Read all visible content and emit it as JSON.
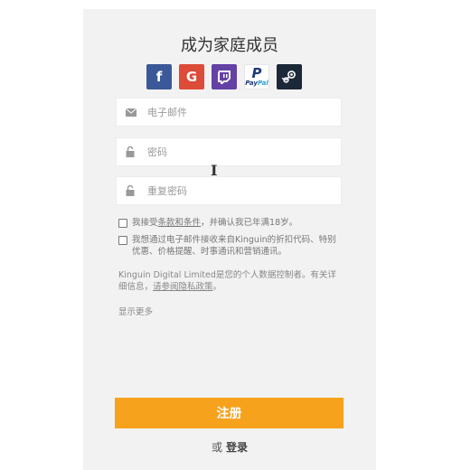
{
  "form": {
    "title": "成为家庭成员",
    "social": {
      "facebook": "f",
      "google": "G",
      "paypal_mark": "P",
      "paypal_pay": "Pay",
      "paypal_pal": "Pal"
    },
    "fields": {
      "email_placeholder": "电子邮件",
      "password_placeholder": "密码",
      "repeat_password_placeholder": "重复密码"
    },
    "checks": {
      "terms_prefix": "我接受",
      "terms_link": "条款和条件",
      "terms_suffix": "，并确认我已年满18岁。",
      "marketing": "我想通过电子邮件接收来自Kinguin的折扣代码、特别优惠、价格提醒、时事通讯和营销通讯。"
    },
    "notice_text": "Kinguin Digital Limited是您的个人数据控制者。有关详细信息，",
    "notice_link": "请参阅隐私政策",
    "notice_end": "。",
    "show_more": "显示更多",
    "register_label": "注册",
    "or_label": "或",
    "login_label": "登录"
  },
  "icons": [
    "facebook-icon",
    "google-icon",
    "twitch-icon",
    "paypal-icon",
    "steam-icon",
    "envelope-icon",
    "lock-icon",
    "text-cursor-icon"
  ],
  "colors": {
    "accent": "#f7a21c",
    "facebook": "#3b5998",
    "google": "#dd4b39",
    "twitch": "#6441a5",
    "steam": "#1b2838",
    "panel": "#f2f2f2"
  }
}
